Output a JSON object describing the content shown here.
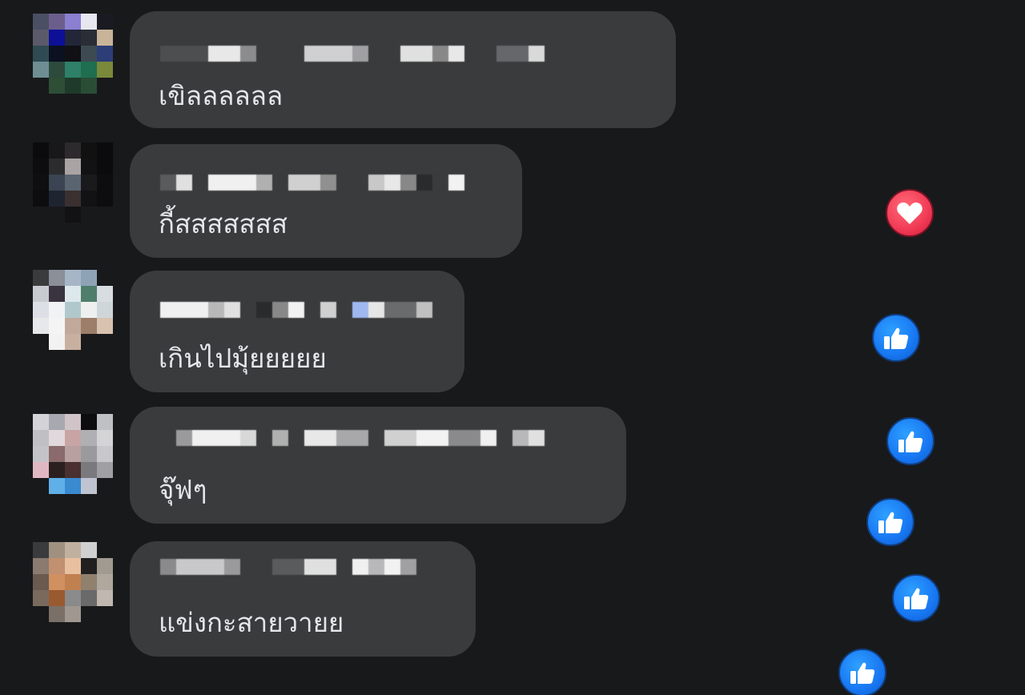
{
  "comments": [
    {
      "text": "เขิลลลลลล",
      "reaction": "none"
    },
    {
      "text": "กี้สสสสสสส",
      "reaction": "love"
    },
    {
      "text": "เกินไปมุ้ยยยยย",
      "reaction": "like"
    },
    {
      "text": "จุ๊ฟๆ",
      "reaction": "like"
    },
    {
      "text": "แข่งกะสายวายย",
      "reaction": "like"
    }
  ],
  "floating_reactions": [
    "heart-icon",
    "thumbs-up-icon",
    "thumbs-up-icon",
    "thumbs-up-icon",
    "thumbs-up-icon",
    "thumbs-up-icon"
  ],
  "colors": {
    "background": "#18191b",
    "bubble": "#3a3b3c",
    "text": "#e4e6eb",
    "like_blue": "#1877f2",
    "love_red": "#f33e58"
  }
}
